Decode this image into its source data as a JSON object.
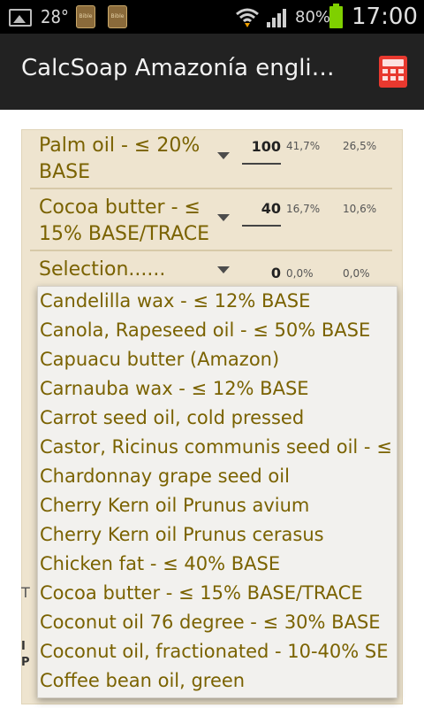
{
  "status_bar": {
    "temperature": "28°",
    "book_label_1": "Bible",
    "book_label_2": "Bible",
    "battery": "80%",
    "time": "17:00"
  },
  "action_bar": {
    "title": "CalcSoap Amazonía engli…",
    "calc_icon": "calculator-icon"
  },
  "recipe_rows": [
    {
      "name": "Palm oil - ≤ 20% BASE",
      "qty": "100",
      "pct1": "41,7%",
      "pct2": "26,5%"
    },
    {
      "name": "Cocoa butter - ≤ 15% BASE/TRACE",
      "qty": "40",
      "pct1": "16,7%",
      "pct2": "10,6%"
    },
    {
      "name": "Selection......",
      "qty": "0",
      "pct1": "0,0%",
      "pct2": "0,0%"
    }
  ],
  "fragments": {
    "left_1": "T",
    "left_2a": "I",
    "left_2b": "P"
  },
  "dropdown_items": [
    "Candelilla wax - ≤ 12% BASE",
    "Canola, Rapeseed oil - ≤ 50% BASE",
    "Capuacu butter (Amazon)",
    "Carnauba wax - ≤ 12% BASE",
    "Carrot seed oil, cold pressed",
    "Castor, Ricinus communis seed oil - ≤",
    "Chardonnay grape seed oil",
    "Cherry Kern oil Prunus avium",
    "Cherry Kern oil Prunus cerasus",
    "Chicken fat - ≤ 40% BASE",
    "Cocoa butter - ≤ 15% BASE/TRACE",
    "Coconut oil 76 degree - ≤ 30% BASE",
    "Coconut oil, fractionated - 10-40% SE",
    "Coffee bean oil, green"
  ],
  "colors": {
    "accent_text": "#7a6200",
    "panel": "#eee4cf",
    "calc_icon": "#e8392f"
  }
}
